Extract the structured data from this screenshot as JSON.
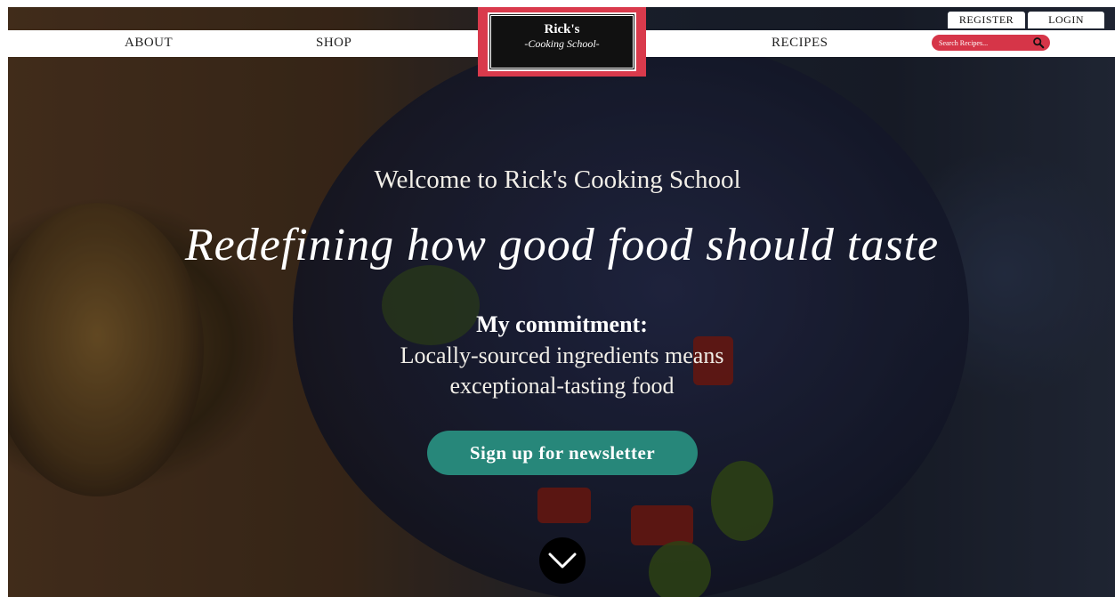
{
  "header": {
    "register_label": "REGISTER",
    "login_label": "LOGIN",
    "nav": {
      "about": "ABOUT",
      "shop": "SHOP",
      "recipes": "RECIPES"
    },
    "search": {
      "placeholder": "Search Recipes...",
      "icon": "search-icon"
    },
    "logo": {
      "title": "Rick's",
      "subtitle": "-Cooking School-"
    }
  },
  "hero": {
    "welcome": "Welcome to Rick's Cooking School",
    "tagline": "Redefining how good food should taste",
    "commitment_title": "My commitment:",
    "commitment_line1": "Locally-sourced ingredients means",
    "commitment_line2": "exceptional-tasting food",
    "cta_label": "Sign up for newsletter",
    "scroll_icon": "chevron-down-icon"
  },
  "colors": {
    "brand_red": "#d93a4c",
    "cta_teal": "#27877a"
  }
}
